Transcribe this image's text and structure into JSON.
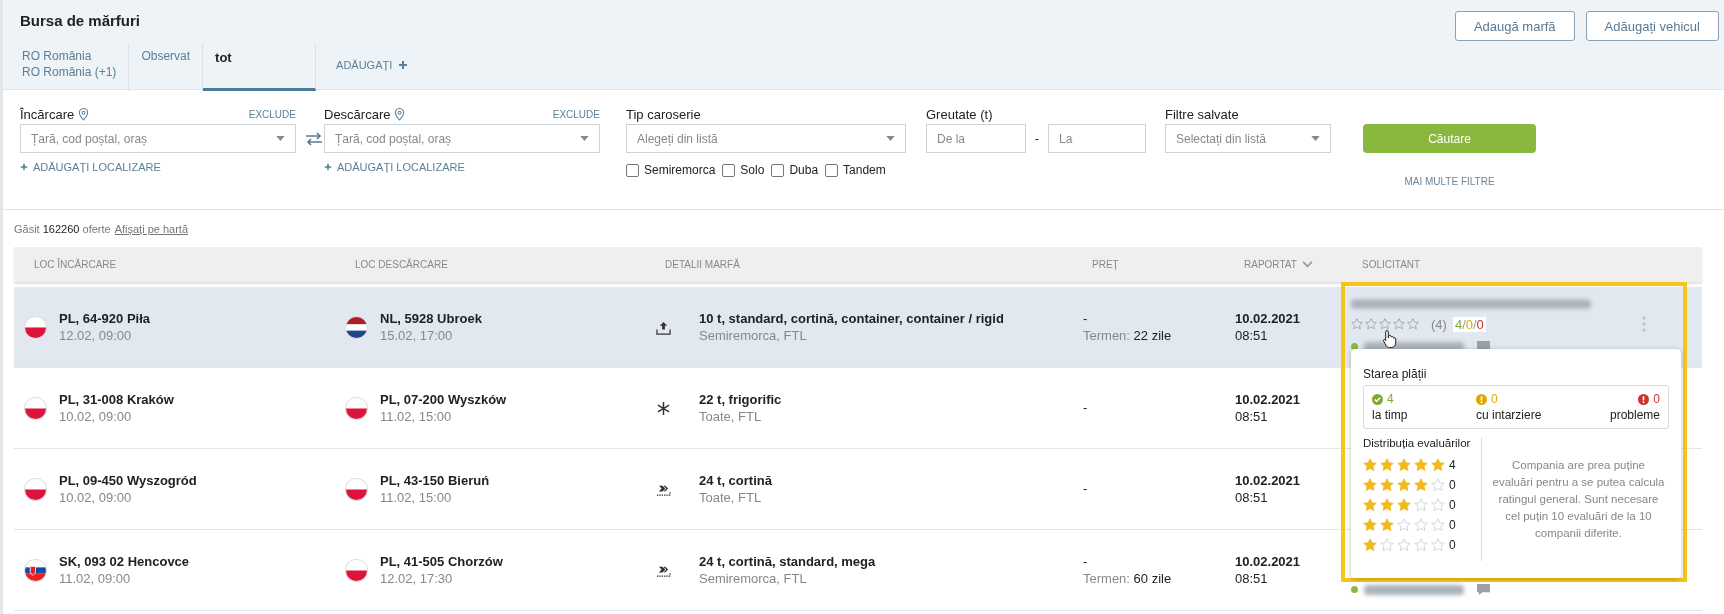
{
  "page": {
    "title": "Bursa de mărfuri"
  },
  "header_buttons": [
    "Adaugă marfă",
    "Adăugați vehicul"
  ],
  "tabs": [
    {
      "lines": [
        "RO România",
        "RO România (+1)"
      ],
      "selected": false
    },
    {
      "lines": [
        "Observat"
      ],
      "selected": false
    },
    {
      "lines": [
        "tot"
      ],
      "selected": true
    }
  ],
  "add_tab": "ADĂUGAȚI",
  "filters": {
    "loading": {
      "label": "Încărcare",
      "exclude": "EXCLUDE",
      "placeholder": "Țară, cod poștal, oraș",
      "add": "ADĂUGAȚI LOCALIZARE"
    },
    "unloading": {
      "label": "Descărcare",
      "exclude": "EXCLUDE",
      "placeholder": "Țară, cod poștal, oraș",
      "add": "ADĂUGAȚI LOCALIZARE"
    },
    "body_type": {
      "label": "Tip caroserie",
      "placeholder": "Alegeți din listă",
      "options": [
        {
          "label": "Semiremorca",
          "checked": false
        },
        {
          "label": "Solo",
          "checked": false
        },
        {
          "label": "Duba",
          "checked": false
        },
        {
          "label": "Tandem",
          "checked": false
        }
      ]
    },
    "weight": {
      "label": "Greutate (t)",
      "from_placeholder": "De la",
      "separator": "-",
      "to_placeholder": "La"
    },
    "saved": {
      "label": "Filtre salvate",
      "placeholder": "Selectați din listă"
    },
    "search_button": "Căutare",
    "more_filters": "MAI MULTE FILTRE"
  },
  "results": {
    "prefix": "Găsit",
    "count": "162260",
    "suffix": "oferte",
    "map_link": "Afișați pe hartă"
  },
  "table": {
    "columns": [
      {
        "label": "LOC ÎNCĂRCARE",
        "sorted": false
      },
      {
        "label": "LOC DESCĂRCARE",
        "sorted": false
      },
      {
        "label": "DETALII MARFĂ",
        "sorted": false
      },
      {
        "label": "PREȚ",
        "sorted": false
      },
      {
        "label": "RAPORTAT",
        "sorted": true
      },
      {
        "label": "SOLICITANT",
        "sorted": false
      }
    ],
    "rows": [
      {
        "selected": true,
        "load": {
          "kind": "pl",
          "place": "PL, 64-920 Piła",
          "date": "12.02, 09:00"
        },
        "unload": {
          "kind": "nl",
          "place": "NL, 5928 Ubroek",
          "date": "15.02, 17:00"
        },
        "cargo": {
          "kind": "top",
          "title": "10 t, standard, cortină, container, container / rigid",
          "sub": "Semiremorca, FTL"
        },
        "price": {
          "value": "-",
          "term_label": "Termen:",
          "term": "22 zile"
        },
        "reported": {
          "date": "10.02.2021",
          "time": "08:51"
        },
        "requester": {
          "stars": 0,
          "reviews": "(4)",
          "payments": [
            {
              "text": "4",
              "kind": "ok"
            },
            {
              "text": "/",
              "kind": "sep"
            },
            {
              "text": "0",
              "kind": "late"
            },
            {
              "text": "/",
              "kind": "sep"
            },
            {
              "text": "0",
              "kind": "problem"
            }
          ],
          "online": true
        }
      },
      {
        "selected": false,
        "load": {
          "kind": "pl",
          "place": "PL, 31-008 Kraków",
          "date": "10.02, 09:00"
        },
        "unload": {
          "kind": "pl",
          "place": "PL, 07-200 Wyszków",
          "date": "11.02, 15:00"
        },
        "cargo": {
          "kind": "frigo",
          "title": "22 t, frigorific",
          "sub": "Toate, FTL"
        },
        "price": {
          "value": "-"
        },
        "reported": {
          "date": "10.02.2021",
          "time": "08:51"
        }
      },
      {
        "selected": false,
        "load": {
          "kind": "pl",
          "place": "PL, 09-450 Wyszogród",
          "date": "10.02, 09:00"
        },
        "unload": {
          "kind": "pl",
          "place": "PL, 43-150 Bieruń",
          "date": "11.02, 15:00"
        },
        "cargo": {
          "kind": "side",
          "title": "24 t, cortină",
          "sub": "Toate, FTL"
        },
        "price": {
          "value": "-"
        },
        "reported": {
          "date": "10.02.2021",
          "time": "08:51"
        }
      },
      {
        "selected": false,
        "load": {
          "kind": "sk",
          "place": "SK, 093 02 Hencovce",
          "date": "11.02, 09:00"
        },
        "unload": {
          "kind": "pl",
          "place": "PL, 41-505 Chorzów",
          "date": "12.02, 17:30"
        },
        "cargo": {
          "kind": "side",
          "title": "24 t, cortină, standard, mega",
          "sub": "Semiremorca, FTL"
        },
        "price": {
          "value": "-",
          "term_label": "Termen:",
          "term": "60 zile"
        },
        "reported": {
          "date": "10.02.2021",
          "time": "08:51"
        },
        "requester": {
          "online": true
        }
      }
    ]
  },
  "payment_popup": {
    "title": "Starea plății",
    "stats": [
      {
        "kind": "ok",
        "value": "4",
        "label": "la timp"
      },
      {
        "kind": "late",
        "value": "0",
        "label": "cu intarziere"
      },
      {
        "kind": "problem",
        "value": "0",
        "label": "probleme"
      }
    ],
    "distribution_title": "Distribuția evaluărilor",
    "distribution": [
      {
        "stars": 5,
        "count": "4"
      },
      {
        "stars": 4,
        "count": "0"
      },
      {
        "stars": 3,
        "count": "0"
      },
      {
        "stars": 2,
        "count": "0"
      },
      {
        "stars": 1,
        "count": "0"
      }
    ],
    "note": "Compania are prea puține evaluări pentru a se putea calcula ratingul general. Sunt necesare cel puțin 10 evaluări de la 10 companii diferite."
  }
}
